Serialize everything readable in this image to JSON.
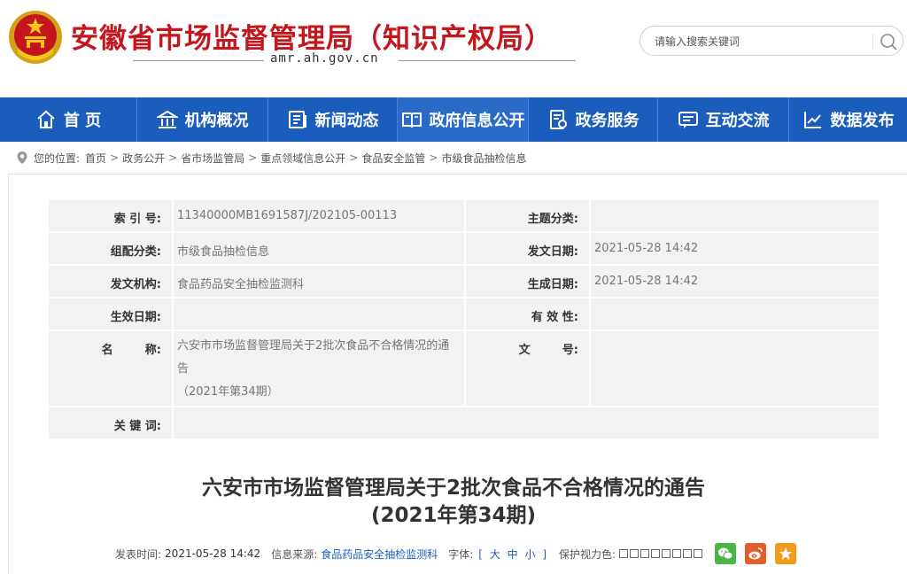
{
  "header": {
    "site_title": "安徽省市场监督管理局（知识产权局）",
    "domain": "amr.ah.gov.cn",
    "search_placeholder": "请输入搜索关键词",
    "brand_red": "#c4161c",
    "emblem_icon": "national-emblem-icon"
  },
  "nav": {
    "color": "#1b5dbc",
    "items": [
      {
        "label": "首 页",
        "icon": "home-icon"
      },
      {
        "label": "机构概况",
        "icon": "building-icon"
      },
      {
        "label": "新闻动态",
        "icon": "news-icon"
      },
      {
        "label": "政府信息公开",
        "icon": "book-icon"
      },
      {
        "label": "政务服务",
        "icon": "service-icon"
      },
      {
        "label": "互动交流",
        "icon": "chat-icon"
      },
      {
        "label": "数据发布",
        "icon": "chart-icon"
      }
    ]
  },
  "breadcrumb": {
    "prefix": "您的位置:",
    "items": [
      "首页",
      "政务公开",
      "省市场监管局",
      "重点领域信息公开",
      "食品安全监管",
      "市级食品抽检信息"
    ]
  },
  "info": {
    "index_label": "索 引 号:",
    "index_value": "11340000MB1691587J/202105-00113",
    "topic_label": "主题分类:",
    "topic_value": "",
    "category_label": "组配分类:",
    "category_value": "市级食品抽检信息",
    "issue_date_label": "发文日期:",
    "issue_date_value": "2021-05-28 14:42",
    "org_label": "发文机构:",
    "org_value": "食品药品安全抽检监测科",
    "gen_date_label": "生成日期:",
    "gen_date_value": "2021-05-28 14:42",
    "effective_label": "生效日期:",
    "effective_value": "",
    "validity_label": "有 效 性:",
    "validity_value": "",
    "name_label": "名        称:",
    "name_line1": "六安市市场监督管理局关于2批次食品不合格情况的通",
    "name_line2": "告",
    "name_line3": "（2021年第34期）",
    "docno_label": "文        号:",
    "docno_value": "",
    "keywords_label": "关 键 词:",
    "keywords_value": ""
  },
  "article": {
    "title_line1": "六安市市场监督管理局关于2批次食品不合格情况的通告",
    "title_line2": "(2021年第34期)",
    "meta": {
      "time_label": "发表时间:",
      "time_value": "2021-05-28 14:42",
      "source_label": "信息来源:",
      "source_value": "食品药品安全抽检监测科",
      "font_label": "字体:",
      "font_open": "[",
      "font_large": "大",
      "font_medium": "中",
      "font_small": "小",
      "font_close": "]",
      "eye_label": "保护视力色:"
    },
    "share": [
      {
        "icon": "wechat-icon",
        "color": "#4bb548"
      },
      {
        "icon": "weibo-icon",
        "color": "#e35d2b"
      },
      {
        "icon": "favorite-star-icon",
        "color": "#f39c1a"
      }
    ]
  }
}
